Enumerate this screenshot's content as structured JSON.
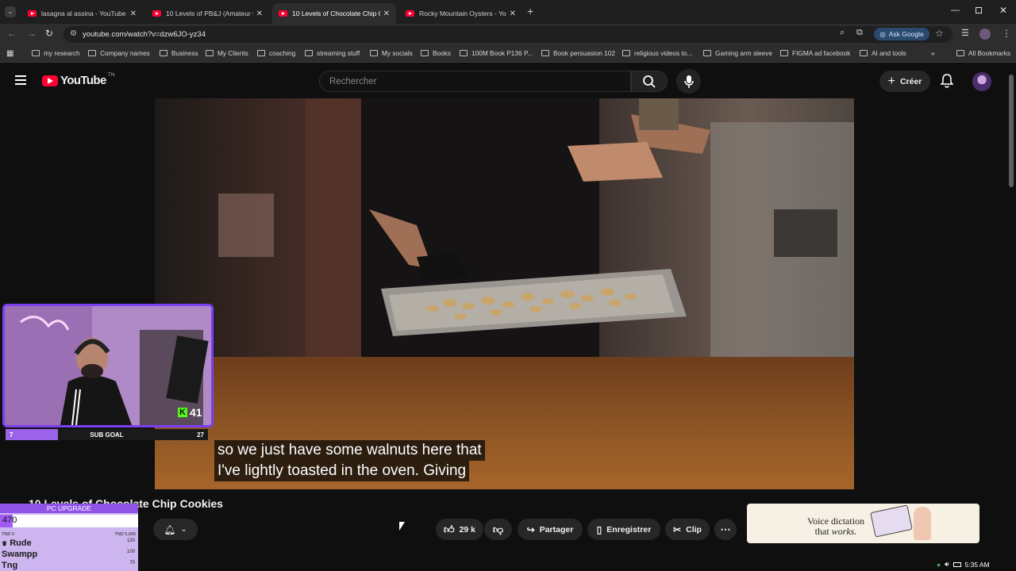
{
  "browser": {
    "tabs": [
      {
        "title": "lasagna al assina - YouTube"
      },
      {
        "title": "10 Levels of PB&J (Amateur to ..."
      },
      {
        "title": "10 Levels of Chocolate Chip Co..."
      },
      {
        "title": "Rocky Mountain Oysters - YouT..."
      }
    ],
    "url": "youtube.com/watch?v=dzw6JO-yz34",
    "ask_google": "Ask Google",
    "bookmarks": [
      "my research",
      "Company names",
      "Business",
      "My Clients",
      "coaching",
      "streaming stuff",
      "My socials",
      "Books",
      "100M Book P136 P...",
      "Book persuasion 102",
      "religious videos to...",
      "Gaming arm sleeve",
      "FIGMA ad facebook",
      "AI and tools"
    ],
    "all_bookmarks": "All Bookmarks"
  },
  "youtube": {
    "logo_text": "YouTube",
    "logo_country": "TN",
    "search_placeholder": "Rechercher",
    "create_label": "Créer"
  },
  "video": {
    "subtitle_line1": "so we just have some walnuts here that",
    "subtitle_line2": "I've lightly toasted in the oven. Giving",
    "title": "10 Levels of Chocolate Chip Cookies",
    "likes": "29 k",
    "share_label": "Partager",
    "save_label": "Enregistrer",
    "clip_label": "Clip"
  },
  "ad": {
    "line1": "Voice dictation",
    "line2": "that",
    "line2_em": "works."
  },
  "webcam": {
    "kick_count": "41",
    "sub_goal_label": "SUB GOAL",
    "sub_goal_current": "7",
    "sub_goal_target": "27",
    "sub_goal_progress": 0.26
  },
  "pc_upgrade": {
    "title": "PC UPGRADE",
    "amount": "470",
    "min_label": "TND 0",
    "max_label": "TND 5,000",
    "progress": 0.094,
    "leaders": [
      {
        "name": "Rude",
        "value": "120"
      },
      {
        "name": "Swampp",
        "value": "100"
      },
      {
        "name": "Tng",
        "value": "70"
      }
    ]
  },
  "system": {
    "time": "5:35 AM"
  },
  "colors": {
    "youtube_red": "#ff0033",
    "stream_purple": "#7b3ff0",
    "kick_green": "#53fc18"
  }
}
